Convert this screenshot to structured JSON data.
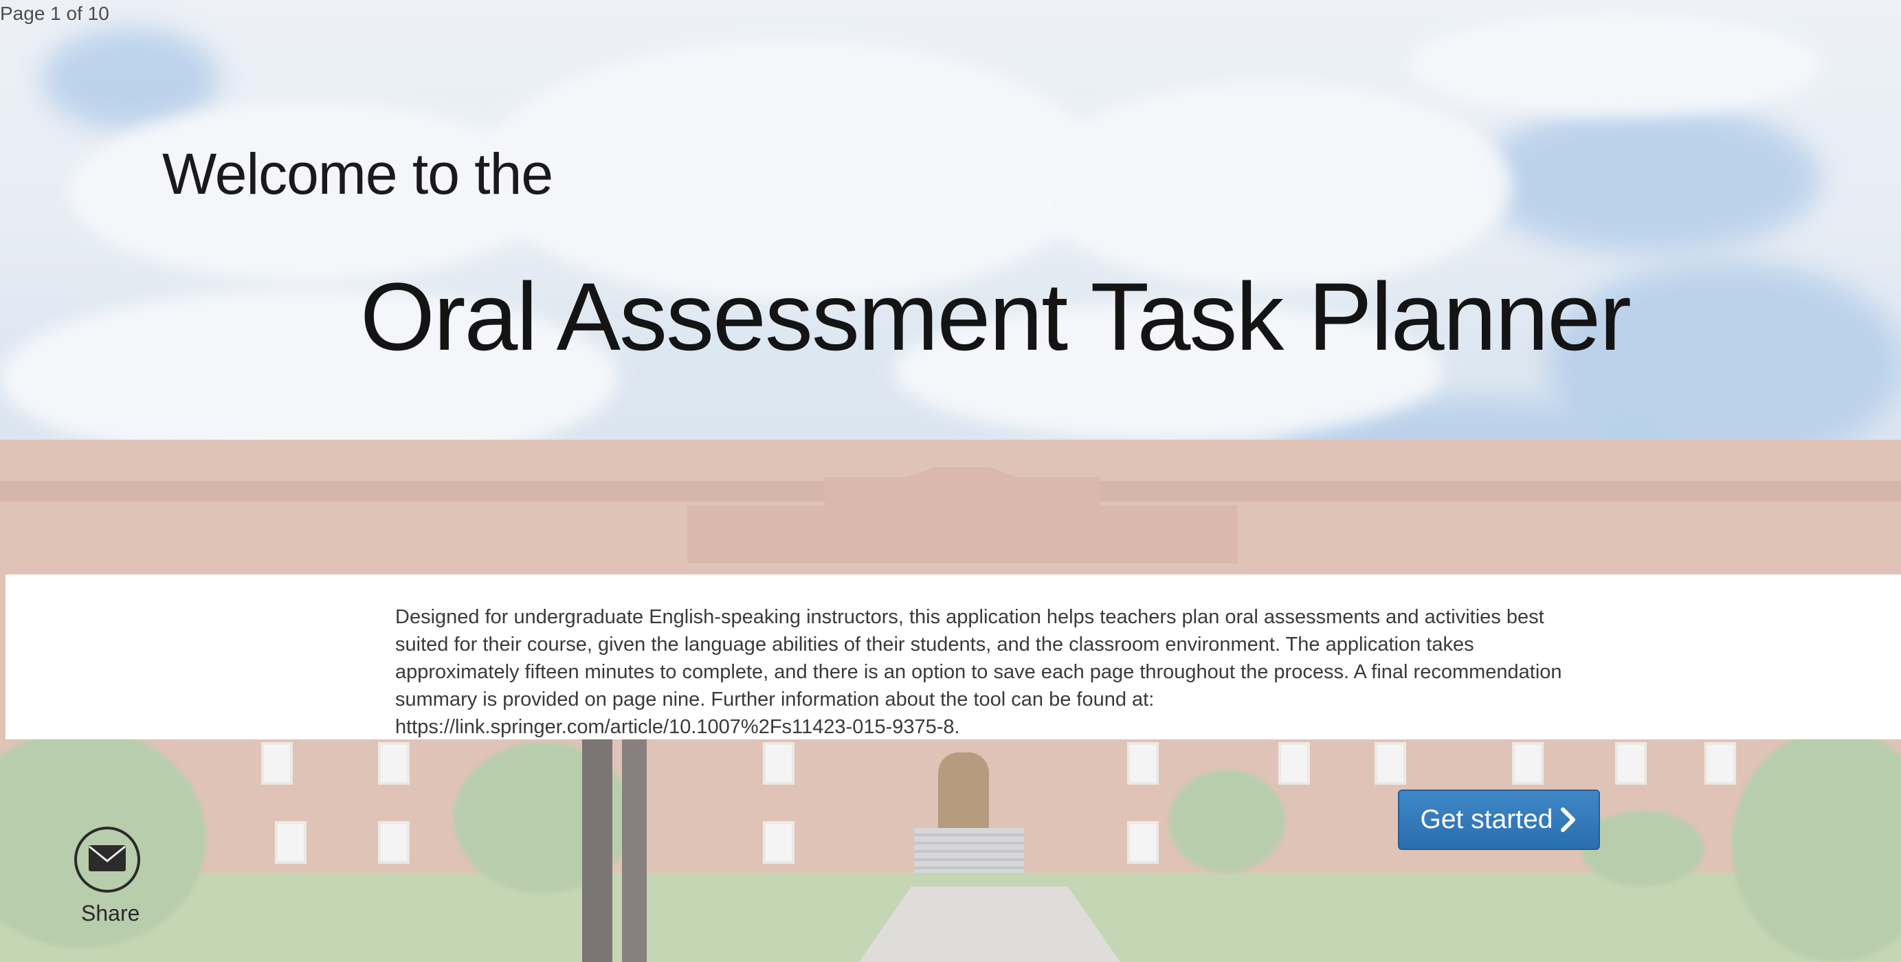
{
  "page_indicator": "Page 1 of 10",
  "header": {
    "welcome": "Welcome to the",
    "title": "Oral Assessment Task Planner"
  },
  "intro": {
    "description": "Designed for undergraduate English-speaking instructors, this application helps teachers plan oral assessments and activities best suited for their course, given the language abilities of their students, and the classroom environment. The application takes approximately fifteen minutes to complete, and there is an option to save each page throughout the process. A final recommendation summary is provided on page nine. Further information about the tool can be found at: https://link.springer.com/article/10.1007%2Fs11423-015-9375-8."
  },
  "actions": {
    "get_started_label": "Get started",
    "get_started_icon": "chevron-right-icon"
  },
  "share": {
    "label": "Share",
    "icon": "envelope-icon"
  },
  "colors": {
    "button_blue": "#2f77b9",
    "panel_white": "#ffffff",
    "title_text": "#141414"
  }
}
